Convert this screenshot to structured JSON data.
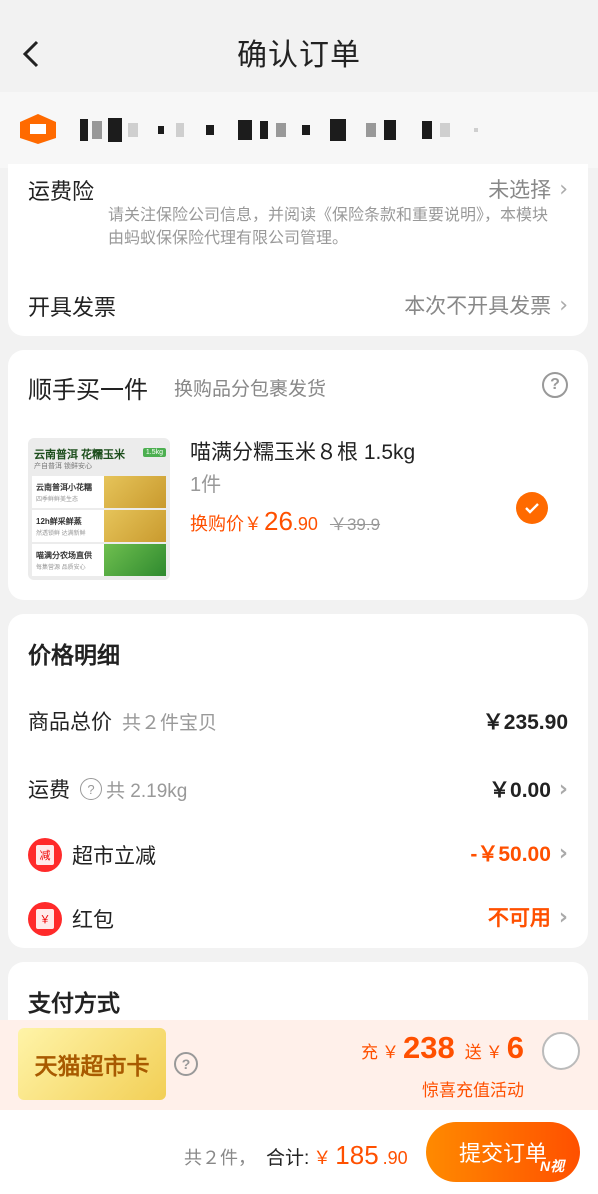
{
  "nav": {
    "title": "确认订单",
    "back_icon": "chevron-left-icon"
  },
  "insurance": {
    "label": "运费险",
    "value": "未选择",
    "note": "请关注保险公司信息，并阅读《保险条款和重要说明》，本模块由蚂蚁保保险代理有限公司管理。"
  },
  "invoice": {
    "label": "开具发票",
    "value": "本次不开具发票"
  },
  "addon": {
    "title": "顺手买一件",
    "subtitle": "换购品分包裹发货",
    "product": {
      "image_title": "云南普洱 花糯玉米",
      "image_tag": "1.5kg",
      "image_sub": "产自普洱 锁鲜安心",
      "image_rows": [
        {
          "title": "云南普洱小花糯",
          "sub": "四季鲜鲜美生态"
        },
        {
          "title": "12h鲜采鲜蒸",
          "sub": "然透锁鲜 达满新鲜"
        },
        {
          "title": "喵满分农场直供",
          "sub": "每集营源 品质安心"
        }
      ],
      "name": "喵满分糯玉米８根 1.5kg",
      "qty": "1件",
      "price_label": "换购价￥",
      "price_int": "26",
      "price_dec": ".90",
      "original_price": "￥39.9"
    }
  },
  "price_detail": {
    "title": "价格明细",
    "rows": [
      {
        "label": "商品总价",
        "extra": "共２件宝贝",
        "value": "￥235.90"
      },
      {
        "label": "运费",
        "extra": "共 2.19kg",
        "value": "￥0.00"
      },
      {
        "label": "超市立减",
        "value": "-￥50.00",
        "badge": "减"
      },
      {
        "label": "红包",
        "value": "不可用",
        "badge": "￥"
      }
    ]
  },
  "payment": {
    "title": "支付方式"
  },
  "promo": {
    "card_label": "天猫超市卡",
    "charge_label": "充",
    "charge_currency": "￥",
    "charge_amount": "238",
    "gift_label": "送",
    "gift_currency": "￥",
    "gift_amount": "6",
    "activity": "惊喜充值活动"
  },
  "footer": {
    "count": "共２件，",
    "total_label": "合计:",
    "currency": "￥",
    "total_int": "185",
    "total_dec": ".90",
    "submit_label": "提交订单",
    "watermark": "N视"
  },
  "colors": {
    "accent": "#ff5000",
    "badge_red": "#ff2a2a",
    "check": "#ff6a00"
  }
}
